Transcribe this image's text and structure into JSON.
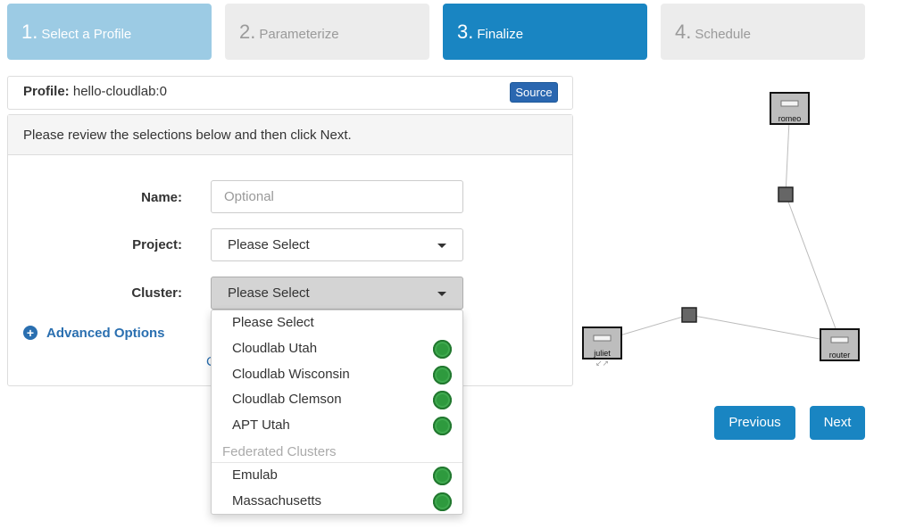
{
  "wizard": {
    "steps": [
      {
        "num": "1.",
        "label": "Select a Profile"
      },
      {
        "num": "2.",
        "label": "Parameterize"
      },
      {
        "num": "3.",
        "label": "Finalize"
      },
      {
        "num": "4.",
        "label": "Schedule"
      }
    ],
    "active_step": 3
  },
  "profile": {
    "label": "Profile:",
    "value": "hello-cloudlab:0",
    "source_button": "Source"
  },
  "panel": {
    "heading": "Please review the selections below and then click Next."
  },
  "form": {
    "name_label": "Name:",
    "name_placeholder": "Optional",
    "project_label": "Project:",
    "project_value": "Please Select",
    "cluster_label": "Cluster:",
    "cluster_value": "Please Select",
    "advanced_options": "Advanced Options",
    "partially_hidden_link": "C"
  },
  "cluster_dropdown": {
    "options": [
      {
        "label": "Please Select",
        "status": null
      },
      {
        "label": "Cloudlab Utah",
        "status": "green"
      },
      {
        "label": "Cloudlab Wisconsin",
        "status": "green"
      },
      {
        "label": "Cloudlab Clemson",
        "status": "green"
      },
      {
        "label": "APT Utah",
        "status": "green"
      }
    ],
    "federated_header": "Federated Clusters",
    "federated_options": [
      {
        "label": "Emulab",
        "status": "green"
      },
      {
        "label": "Massachusetts",
        "status": "green"
      }
    ]
  },
  "buttons": {
    "previous": "Previous",
    "next": "Next"
  },
  "topology": {
    "nodes": [
      "romeo",
      "juliet",
      "router"
    ]
  },
  "colors": {
    "accent": "#1985c2",
    "done_step": "#9ccbe4",
    "todo_step": "#ececec",
    "status_green": "#2e9a3e",
    "link": "#2a6fb0"
  }
}
